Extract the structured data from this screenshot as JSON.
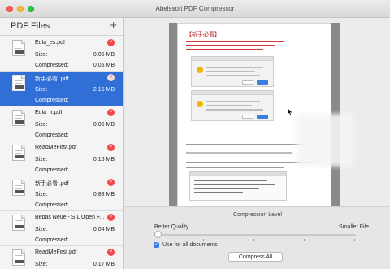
{
  "window": {
    "title": "Abelssoft PDF Compressor"
  },
  "sidebar": {
    "title": "PDF Files",
    "add_label": "+",
    "size_label": "Size:",
    "compressed_label": "Compressed:",
    "remove_glyph": "×",
    "files": [
      {
        "name": "Eula_es.pdf",
        "size": "0.05 MB",
        "compressed": "0.05 MB",
        "selected": false
      },
      {
        "name": "新手必看 .pdf",
        "size": "2.15 MB",
        "compressed": "",
        "selected": true
      },
      {
        "name": "Eula_fr.pdf",
        "size": "0.05 MB",
        "compressed": "",
        "selected": false
      },
      {
        "name": "ReadMeFirst.pdf",
        "size": "0.16 MB",
        "compressed": "",
        "selected": false
      },
      {
        "name": "新手必看 .pdf",
        "size": "0.83 MB",
        "compressed": "",
        "selected": false
      },
      {
        "name": "Bebas Neue - SIL Open F...",
        "size": "0.04 MB",
        "compressed": "",
        "selected": false
      },
      {
        "name": "ReadMeFirst.pdf",
        "size": "0.17 MB",
        "compressed": "",
        "selected": false
      }
    ]
  },
  "preview": {
    "heading": "【新手必看】"
  },
  "compression": {
    "title": "Compression Level",
    "better_label": "Better Quality",
    "smaller_label": "Smaller File",
    "level": 0,
    "checkbox_label": "Use for all documents",
    "checkbox_checked": true,
    "compress_button": "Compress All"
  },
  "colors": {
    "selection": "#2f6fd6",
    "remove": "#f24a4a",
    "accent": "#3a7be0"
  }
}
